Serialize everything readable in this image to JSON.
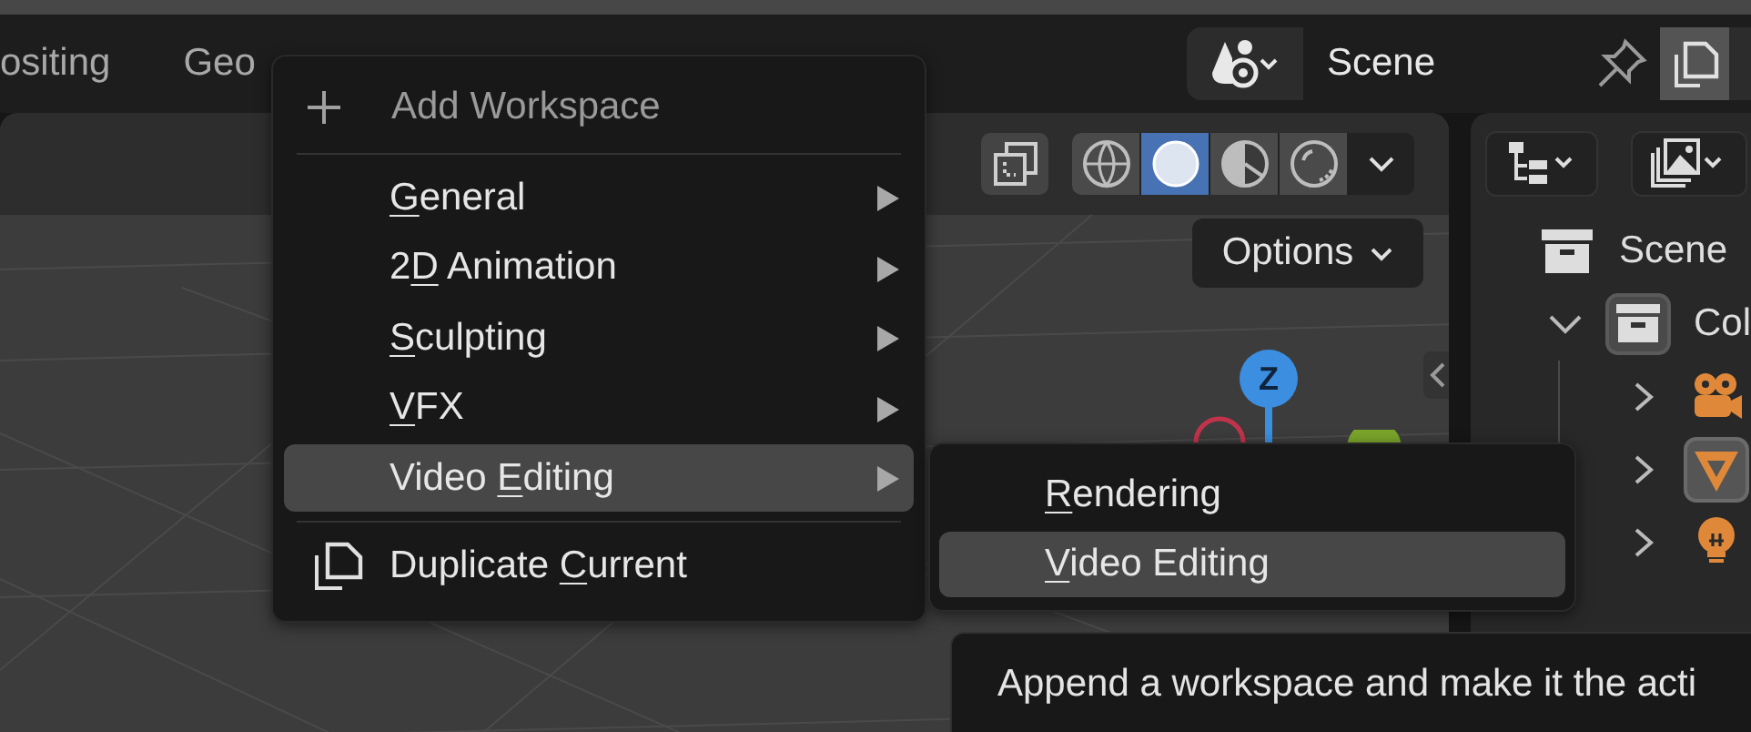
{
  "workspace_tabs": [
    {
      "label": "ositing",
      "selected": false
    },
    {
      "label": "Geo",
      "selected": false
    }
  ],
  "scene_selector": {
    "value": "Scene"
  },
  "viewport": {
    "shading_modes": [
      {
        "kind": "wireframe",
        "selected": false
      },
      {
        "kind": "solid",
        "selected": true
      },
      {
        "kind": "material",
        "selected": false
      },
      {
        "kind": "rendered",
        "selected": false
      }
    ],
    "options_button": "Options",
    "gizmo_axis": "Z"
  },
  "outliner": {
    "scene_label": "Scene",
    "collection": {
      "label": "Col",
      "expanded": true,
      "children": [
        {
          "kind": "camera",
          "expanded": false,
          "selected": false
        },
        {
          "kind": "mesh",
          "expanded": false,
          "selected": true
        },
        {
          "kind": "light",
          "expanded": false,
          "selected": false
        }
      ]
    }
  },
  "add_menu": {
    "title": "Add Workspace",
    "items": [
      {
        "kind": "submenu",
        "key": "G",
        "after": "eneral",
        "selected": false
      },
      {
        "kind": "submenu",
        "before": "2",
        "key": "D",
        "after": " Animation",
        "selected": false
      },
      {
        "kind": "submenu",
        "key": "S",
        "after": "culpting",
        "selected": false
      },
      {
        "kind": "submenu",
        "key": "V",
        "after": "FX",
        "selected": false
      },
      {
        "kind": "submenu",
        "before": "Video ",
        "key": "E",
        "after": "diting",
        "selected": true
      },
      {
        "kind": "duplicate",
        "before": "Duplicate ",
        "key": "C",
        "after": "urrent",
        "selected": false
      }
    ]
  },
  "submenu": {
    "items": [
      {
        "key": "R",
        "after": "endering",
        "selected": false
      },
      {
        "key": "V",
        "after": "ideo Editing",
        "selected": true
      }
    ]
  },
  "tooltip": {
    "text": "Append a workspace and make it the acti"
  }
}
